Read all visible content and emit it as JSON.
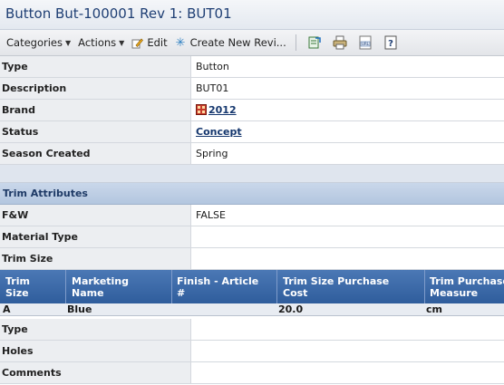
{
  "window": {
    "title": "Button But-100001 Rev 1: BUT01"
  },
  "toolbar": {
    "categories": "Categories",
    "actions": "Actions",
    "edit": "Edit",
    "create_new": "Create New Revi...",
    "icons": [
      "export-icon",
      "print-icon",
      "url-icon",
      "help-icon"
    ]
  },
  "details": [
    {
      "label": "Type",
      "value": "Button"
    },
    {
      "label": "Description",
      "value": "BUT01"
    },
    {
      "label": "Brand",
      "value": "2012"
    },
    {
      "label": "Status",
      "value": "Concept"
    },
    {
      "label": "Season Created",
      "value": "Spring"
    }
  ],
  "trim_section": {
    "title": "Trim Attributes",
    "rows": [
      {
        "label": "F&W",
        "value": "FALSE"
      },
      {
        "label": "Material Type",
        "value": ""
      },
      {
        "label": "Trim Size",
        "value": ""
      }
    ]
  },
  "trim_table": {
    "headers": [
      "Trim Size",
      "Marketing Name",
      "Finish - Article #",
      "Trim Size Purchase Cost",
      "Trim Purchase Measure"
    ],
    "header_lines": [
      [
        "Trim",
        "Size"
      ],
      [
        "Marketing",
        "Name"
      ],
      [
        "Finish - Article",
        "#"
      ],
      [
        "Trim Size Purchase",
        "Cost"
      ],
      [
        "Trim Purchase",
        "Measure"
      ]
    ],
    "rows": [
      [
        "A",
        "Blue",
        "",
        "20.0",
        "cm"
      ]
    ]
  },
  "more_rows": [
    {
      "label": "Type",
      "value": ""
    },
    {
      "label": "Holes",
      "value": ""
    },
    {
      "label": "Comments",
      "value": ""
    }
  ],
  "colors": {
    "accent": "#1f3f74",
    "grid_header": "#3b67a7",
    "section": "#bccde4"
  }
}
